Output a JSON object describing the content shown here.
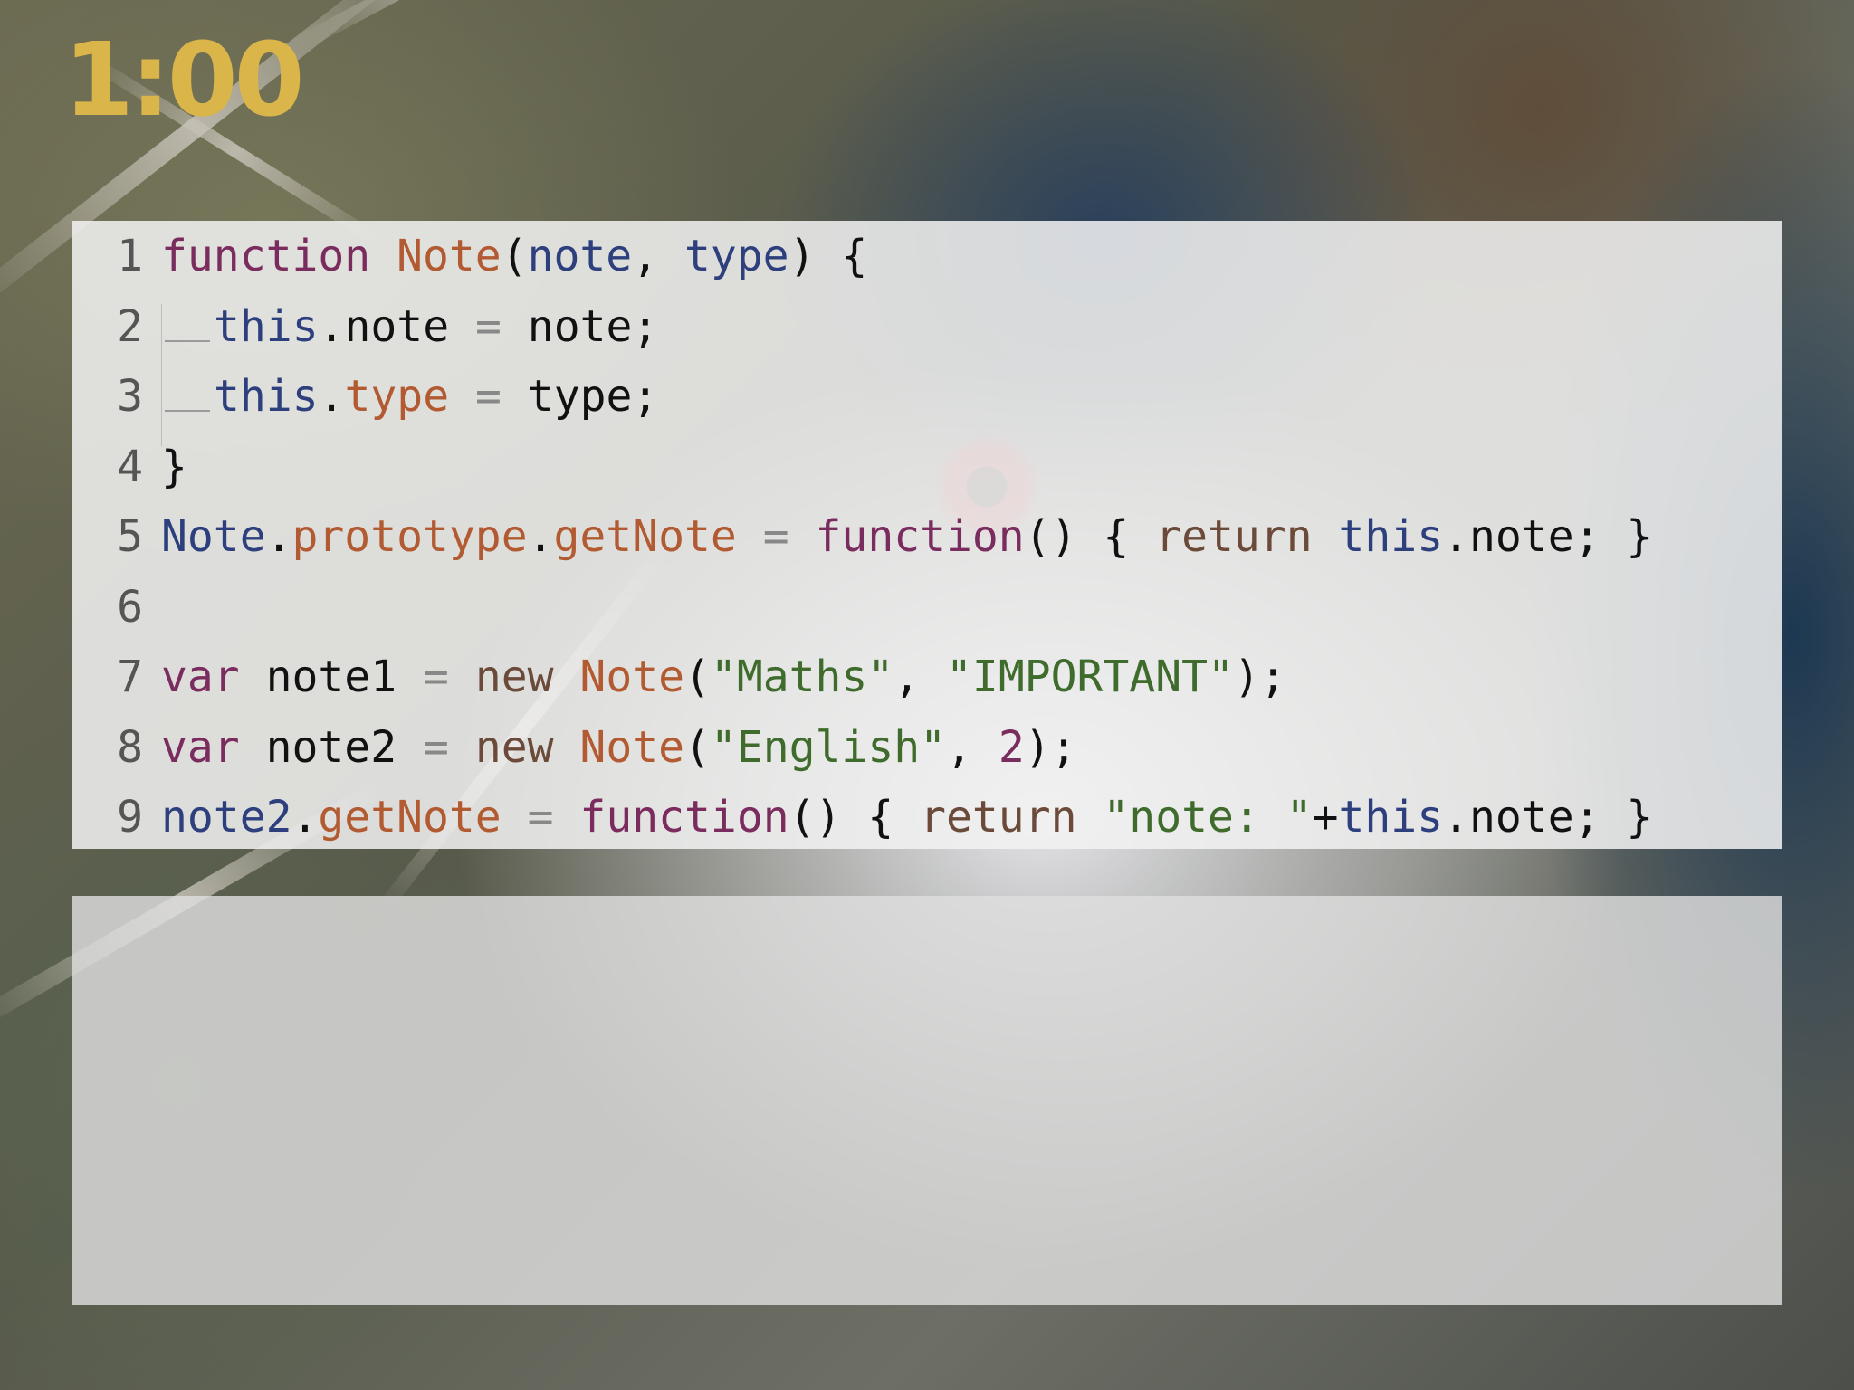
{
  "timer": {
    "text": "1:00",
    "color": "#d9b54a"
  },
  "code": {
    "lines": [
      {
        "no": "1",
        "tokens": [
          {
            "t": "function",
            "c": "kw"
          },
          {
            "t": " "
          },
          {
            "t": "Note",
            "c": "fn"
          },
          {
            "t": "("
          },
          {
            "t": "note",
            "c": "var"
          },
          {
            "t": ", "
          },
          {
            "t": "type",
            "c": "var"
          },
          {
            "t": ") {"
          }
        ]
      },
      {
        "no": "2",
        "indent": true,
        "tokens": [
          {
            "t": "this",
            "c": "var"
          },
          {
            "t": ".note "
          },
          {
            "t": "=",
            "c": "op"
          },
          {
            "t": " note;"
          }
        ]
      },
      {
        "no": "3",
        "indent": true,
        "tokens": [
          {
            "t": "this",
            "c": "var"
          },
          {
            "t": "."
          },
          {
            "t": "type",
            "c": "fn"
          },
          {
            "t": " "
          },
          {
            "t": "=",
            "c": "op"
          },
          {
            "t": " type;"
          }
        ]
      },
      {
        "no": "4",
        "tokens": [
          {
            "t": "}"
          }
        ]
      },
      {
        "no": "5",
        "tokens": [
          {
            "t": "Note",
            "c": "var"
          },
          {
            "t": "."
          },
          {
            "t": "prototype",
            "c": "fn"
          },
          {
            "t": "."
          },
          {
            "t": "getNote",
            "c": "fn"
          },
          {
            "t": " "
          },
          {
            "t": "=",
            "c": "op"
          },
          {
            "t": " "
          },
          {
            "t": "function",
            "c": "kw"
          },
          {
            "t": "() { "
          },
          {
            "t": "return",
            "c": "ret"
          },
          {
            "t": " "
          },
          {
            "t": "this",
            "c": "var"
          },
          {
            "t": ".note; }"
          }
        ]
      },
      {
        "no": "6",
        "tokens": []
      },
      {
        "no": "7",
        "tokens": [
          {
            "t": "var",
            "c": "kw"
          },
          {
            "t": " note1 "
          },
          {
            "t": "=",
            "c": "op"
          },
          {
            "t": " "
          },
          {
            "t": "new",
            "c": "ret"
          },
          {
            "t": " "
          },
          {
            "t": "Note",
            "c": "fn"
          },
          {
            "t": "("
          },
          {
            "t": "\"Maths\"",
            "c": "str"
          },
          {
            "t": ", "
          },
          {
            "t": "\"IMPORTANT\"",
            "c": "str"
          },
          {
            "t": ");"
          }
        ]
      },
      {
        "no": "8",
        "tokens": [
          {
            "t": "var",
            "c": "kw"
          },
          {
            "t": " note2 "
          },
          {
            "t": "=",
            "c": "op"
          },
          {
            "t": " "
          },
          {
            "t": "new",
            "c": "ret"
          },
          {
            "t": " "
          },
          {
            "t": "Note",
            "c": "fn"
          },
          {
            "t": "("
          },
          {
            "t": "\"English\"",
            "c": "str"
          },
          {
            "t": ", "
          },
          {
            "t": "2",
            "c": "num"
          },
          {
            "t": ");"
          }
        ]
      },
      {
        "no": "9",
        "tokens": [
          {
            "t": "note2",
            "c": "var"
          },
          {
            "t": "."
          },
          {
            "t": "getNote",
            "c": "fn"
          },
          {
            "t": " "
          },
          {
            "t": "=",
            "c": "op"
          },
          {
            "t": " "
          },
          {
            "t": "function",
            "c": "kw"
          },
          {
            "t": "() { "
          },
          {
            "t": "return",
            "c": "ret"
          },
          {
            "t": " "
          },
          {
            "t": "\"note: \"",
            "c": "str"
          },
          {
            "t": "+"
          },
          {
            "t": "this",
            "c": "var"
          },
          {
            "t": ".note; }"
          }
        ]
      }
    ]
  },
  "answer_panel": {
    "text": ""
  }
}
